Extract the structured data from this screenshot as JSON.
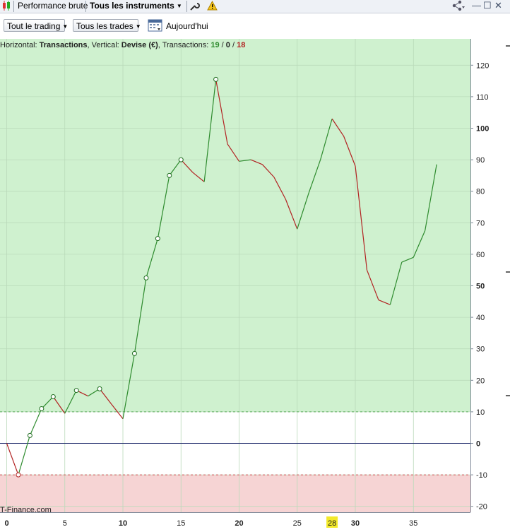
{
  "top_bar": {
    "tab_label": "Performance brute",
    "instrument_selector": "Tous les instruments"
  },
  "toolbar": {
    "trading_filter": "Tout le trading",
    "trades_filter": "Tous les trades",
    "today_label": "Aujourd'hui"
  },
  "header": {
    "prefix": "Horizontal: ",
    "horizontal_value": "Transactions",
    "vertical_prefix": ", Vertical: ",
    "vertical_value": "Devise (€)",
    "count_prefix": ", Transactions: ",
    "wins": "19",
    "neutral": "0",
    "losses": "18",
    "slash": " / "
  },
  "watermark": "T-Finance.com",
  "colors": {
    "win_zone": "#cff1cf",
    "loss_zone": "#f6d4d4",
    "up_segment": "#2e8b2e",
    "down_segment": "#b22222",
    "zero_line": "#1f2a6b",
    "highlight": "#f3e92a"
  },
  "chart_data": {
    "type": "line",
    "x": [
      0,
      1,
      2,
      3,
      4,
      5,
      6,
      7,
      8,
      9,
      10,
      11,
      12,
      13,
      14,
      15,
      16,
      17,
      18,
      19,
      20,
      21,
      22,
      23,
      24,
      25,
      26,
      27,
      28,
      29,
      30,
      31,
      32,
      33,
      34,
      35,
      36,
      37
    ],
    "values": [
      0,
      -10,
      2.5,
      11,
      14.8,
      9.5,
      16.8,
      15,
      17.3,
      12.5,
      7.8,
      28.5,
      52.5,
      65,
      85,
      90,
      86,
      83,
      115.5,
      95,
      89.5,
      90,
      88.5,
      84.5,
      77.5,
      68,
      79.5,
      90,
      103,
      97.5,
      88,
      55,
      45.5,
      44,
      57.5,
      59,
      67.5,
      88.5
    ],
    "markers_x": [
      1,
      2,
      3,
      4,
      6,
      8,
      11,
      12,
      13,
      14,
      15,
      18
    ],
    "xlim": [
      0,
      40
    ],
    "ylim": [
      -20,
      120
    ],
    "x_ticks": [
      0,
      5,
      10,
      15,
      20,
      25,
      30,
      35
    ],
    "highlighted_x": 28,
    "y_ticks": [
      120,
      110,
      100,
      90,
      80,
      70,
      60,
      50,
      40,
      30,
      20,
      10,
      0,
      -10,
      -20
    ],
    "y_ticks_bold": [
      100,
      50,
      0
    ],
    "threshold_upper": 10,
    "threshold_lower": -10,
    "grid": true
  }
}
